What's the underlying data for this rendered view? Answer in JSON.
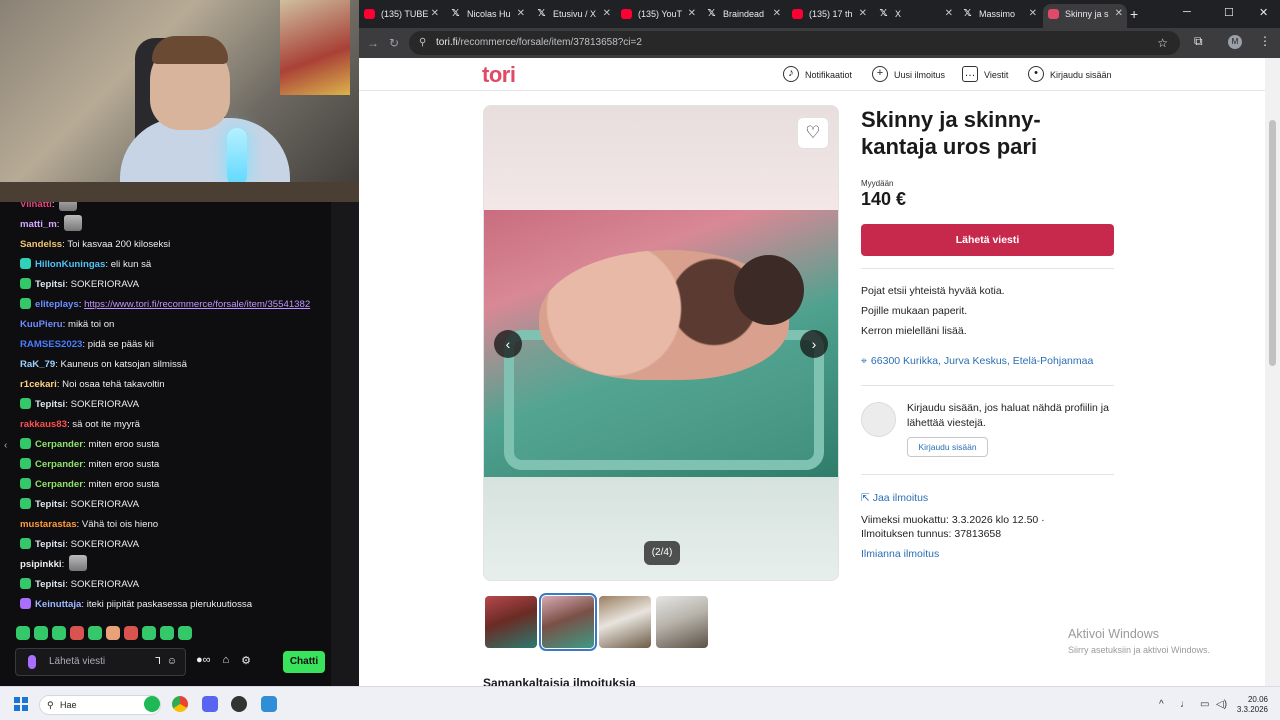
{
  "chat": {
    "lines": [
      {
        "user": "Viinatti",
        "text": "",
        "color": "#e0457b",
        "badge": "",
        "emote": true
      },
      {
        "user": "matti_m",
        "text": "",
        "color": "#d1a8ff",
        "badge": "",
        "emote": true
      },
      {
        "user": "Sandelss",
        "text": "Toi kasvaa 200 kiloseksi",
        "color": "#f0c674",
        "badge": ""
      },
      {
        "user": "HillonKuningas",
        "text": "eli kun sä",
        "color": "#4fc3f7",
        "badge": "teal"
      },
      {
        "user": "Tepitsi",
        "text": "SOKERIORAVA",
        "color": "#dfe6ef",
        "badge": "green"
      },
      {
        "user": "eliteplays",
        "text": "",
        "color": "#6e8cff",
        "badge": "green",
        "link": "https://www.tori.fi/recommerce/forsale/item/35541382"
      },
      {
        "user": "KuuPieru",
        "text": "mikä toi on",
        "color": "#6e8cff",
        "badge": ""
      },
      {
        "user": "RAMSES2023",
        "text": "pidä se pääs kii",
        "color": "#4a7dff",
        "badge": ""
      },
      {
        "user": "RaK_79",
        "text": "Kauneus on katsojan silmissä",
        "color": "#9fd3ff",
        "badge": ""
      },
      {
        "user": "r1cekari",
        "text": "Noi osaa tehä takavoltin",
        "color": "#ffd27f",
        "badge": ""
      },
      {
        "user": "Tepitsi",
        "text": "SOKERIORAVA",
        "color": "#dfe6ef",
        "badge": "green"
      },
      {
        "user": "rakkaus83",
        "text": "sä oot ite myyrä",
        "color": "#ff4f4f",
        "badge": ""
      },
      {
        "user": "Cerpander",
        "text": "miten eroo susta",
        "color": "#8fe36b",
        "badge": "green"
      },
      {
        "user": "Cerpander",
        "text": "miten eroo susta",
        "color": "#8fe36b",
        "badge": "green"
      },
      {
        "user": "Cerpander",
        "text": "miten eroo susta",
        "color": "#8fe36b",
        "badge": "green"
      },
      {
        "user": "Tepitsi",
        "text": "SOKERIORAVA",
        "color": "#dfe6ef",
        "badge": "green"
      },
      {
        "user": "mustarastas",
        "text": "Vähä toi ois hieno",
        "color": "#ff9a3c",
        "badge": ""
      },
      {
        "user": "Tepitsi",
        "text": "SOKERIORAVA",
        "color": "#dfe6ef",
        "badge": "green"
      },
      {
        "user": "psipinkki",
        "text": "",
        "color": "#efeff1",
        "badge": "",
        "emote": true
      },
      {
        "user": "Tepitsi",
        "text": "SOKERIORAVA",
        "color": "#dfe6ef",
        "badge": "green"
      },
      {
        "user": "Keinuttaja",
        "text": "iteki piipität paskasessa pierukuutiossa",
        "color": "#9fb8ff",
        "badge": "purple"
      }
    ],
    "input_placeholder": "Lähetä viesti",
    "send_label": "Chatti"
  },
  "browser": {
    "tabs": [
      {
        "label": "(135) TUBE",
        "icon": "youtube-icon"
      },
      {
        "label": "Nicolas Hu",
        "icon": "x-icon"
      },
      {
        "label": "Etusivu / X",
        "icon": "x-icon"
      },
      {
        "label": "(135) YouT",
        "icon": "youtube-icon"
      },
      {
        "label": "Braindead",
        "icon": "x-icon"
      },
      {
        "label": "(135) 17 th",
        "icon": "youtube-icon"
      },
      {
        "label": "X",
        "icon": "x-icon"
      },
      {
        "label": "Massimo",
        "icon": "x-icon"
      },
      {
        "label": "Skinny ja s",
        "icon": "tori-icon"
      }
    ],
    "url_host": "tori.fi",
    "url_path": "/recommerce/forsale/item/37813658?ci=2",
    "profile_initial": "M"
  },
  "site": {
    "logo": "tori",
    "nav": {
      "notifications": "Notifikaatiot",
      "new_ad": "Uusi ilmoitus",
      "messages": "Viestit",
      "login": "Kirjaudu sisään"
    }
  },
  "listing": {
    "title": "Skinny ja skinny-kantaja uros pari",
    "price_label": "Myydään",
    "price": "140 €",
    "cta": "Lähetä viesti",
    "description": [
      "Pojat etsii yhteistä hyvää kotia.",
      "Pojille mukaan paperit.",
      "Kerron mielelläni lisää."
    ],
    "location": "66300 Kurikka, Jurva Keskus, Etelä-Pohjanmaa",
    "login_prompt": "Kirjaudu sisään, jos haluat nähdä profiilin ja lähettää viestejä.",
    "login_button": "Kirjaudu sisään",
    "share": "Jaa ilmoitus",
    "modified": "Viimeksi muokattu: 3.3.2026 klo 12.50",
    "ad_id": "Ilmoituksen tunnus: 37813658",
    "report": "Ilmianna ilmoitus",
    "image_counter": "(2/4)",
    "thumbnails_count": 4,
    "selected_thumbnail": 2,
    "section_heading": "Samankaltaisia ilmoituksia"
  },
  "watermark": {
    "line1": "Aktivoi Windows",
    "line2": "Siirry asetuksiin ja aktivoi Windows."
  },
  "taskbar": {
    "search": "Hae",
    "time": "20.06",
    "date": "3.3.2026"
  }
}
